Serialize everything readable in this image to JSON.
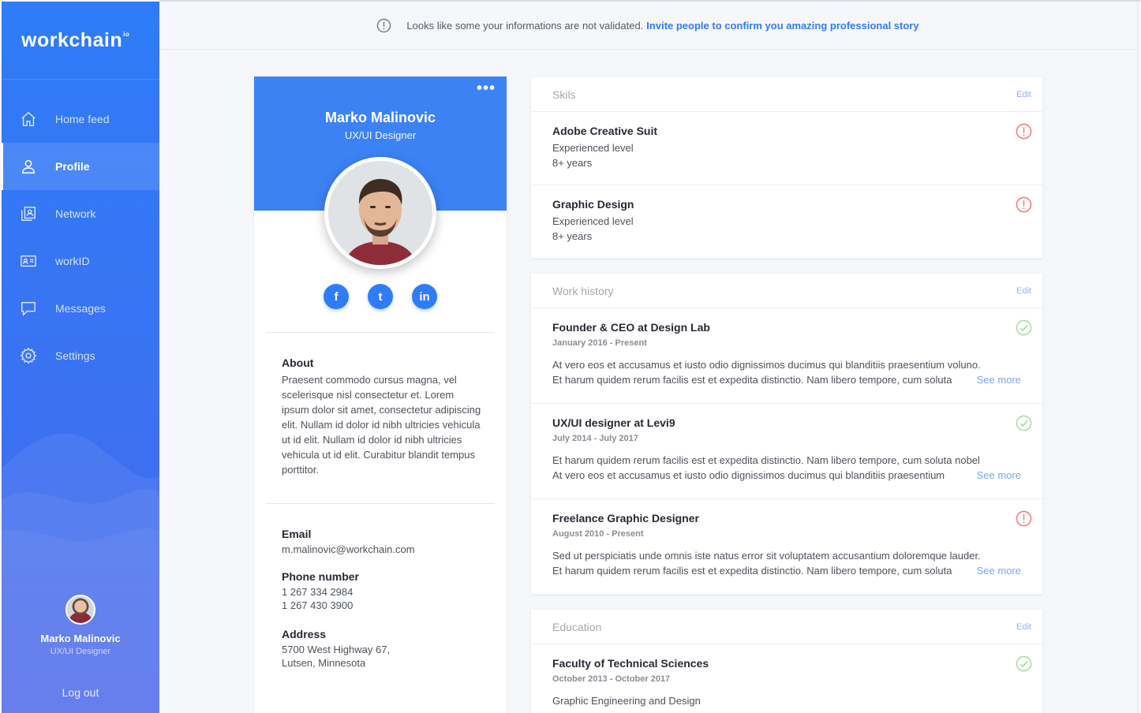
{
  "sidebar": {
    "logo": "workchain",
    "logo_sup": "io",
    "items": [
      {
        "label": "Home feed",
        "icon": "home-icon"
      },
      {
        "label": "Profile",
        "icon": "user-icon"
      },
      {
        "label": "Network",
        "icon": "network-icon"
      },
      {
        "label": "workID",
        "icon": "id-card-icon"
      },
      {
        "label": "Messages",
        "icon": "message-icon"
      },
      {
        "label": "Settings",
        "icon": "gear-icon"
      }
    ],
    "active": "Profile",
    "user": {
      "name": "Marko Malinovic",
      "role": "UX/UI Designer"
    },
    "logout": "Log out"
  },
  "banner": {
    "text": "Looks like some your informations are not validated.",
    "link": "Invite people to confirm you amazing professional story"
  },
  "profile": {
    "name": "Marko Malinovic",
    "role": "UX/UI Designer",
    "social": [
      "f",
      "t",
      "in"
    ],
    "about_label": "About",
    "about_text": "Praesent commodo cursus magna, vel scelerisque nisl consectetur et. Lorem ipsum dolor sit amet, consectetur adipiscing elit. Nullam id dolor id nibh ultricies vehicula ut id elit. Nullam id dolor id nibh ultricies vehicula ut id elit. Curabitur blandit tempus porttitor.",
    "email_label": "Email",
    "email": "m.malinovic@workchain.com",
    "phone_label": "Phone number",
    "phone1": "1 267 334 2984",
    "phone2": "1 267 430 3900",
    "address_label": "Address",
    "address1": "5700 West Highway 67,",
    "address2": "Lutsen, Minnesota"
  },
  "skills": {
    "title": "Skils",
    "edit": "Edit",
    "items": [
      {
        "name": "Adobe Creative Suit",
        "level": "Experienced level",
        "years": "8+ years",
        "status": "warning"
      },
      {
        "name": "Graphic Design",
        "level": "Experienced level",
        "years": "8+ years",
        "status": "warning"
      }
    ]
  },
  "work": {
    "title": "Work history",
    "edit": "Edit",
    "see_more": "See more",
    "items": [
      {
        "title": "Founder & CEO at Design Lab",
        "date": "January 2016 - Present",
        "line1": "At vero eos et accusamus et iusto odio dignissimos ducimus qui blanditiis  praesentium voluno.",
        "line2": "Et harum quidem rerum facilis est et expedita distinctio. Nam libero tempore, cum soluta",
        "status": "verified"
      },
      {
        "title": "UX/UI designer at Levi9",
        "date": "July 2014 - July 2017",
        "line1": "Et harum quidem rerum facilis est et expedita distinctio. Nam libero tempore, cum soluta nobel",
        "line2": "At vero eos et accusamus et iusto odio dignissimos ducimus qui blanditiis  praesentium",
        "status": "verified"
      },
      {
        "title": "Freelance Graphic Designer",
        "date": "August 2010 - Present",
        "line1": "Sed ut perspiciatis unde omnis iste natus error sit voluptatem accusantium doloremque lauder.",
        "line2": "Et harum quidem rerum facilis est et expedita distinctio. Nam libero tempore, cum soluta",
        "status": "warning"
      }
    ]
  },
  "education": {
    "title": "Education",
    "edit": "Edit",
    "items": [
      {
        "title": "Faculty of Technical Sciences",
        "date": "October 2013 - October 2017",
        "line1": "Graphic Engineering and Design",
        "status": "verified"
      }
    ]
  },
  "colors": {
    "primary": "#2f7cf6",
    "warning": "#f07c7c",
    "verified": "#a6dea6"
  }
}
